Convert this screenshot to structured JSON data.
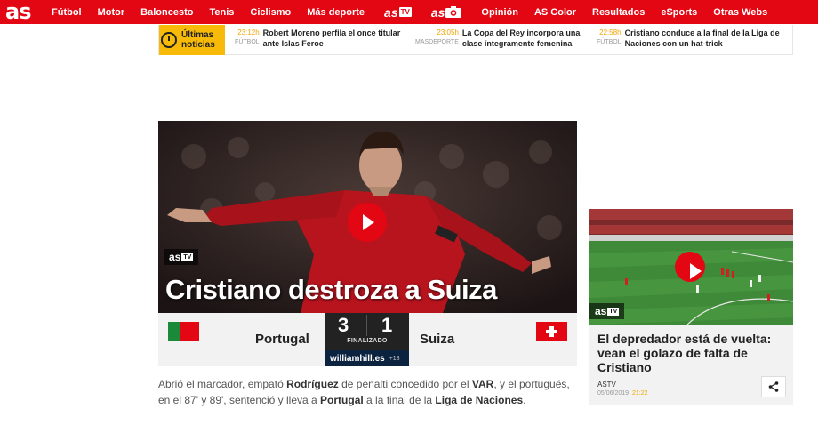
{
  "nav": {
    "logo": "as",
    "items": [
      "Fútbol",
      "Motor",
      "Baloncesto",
      "Tenis",
      "Ciclismo",
      "Más deporte"
    ],
    "astv_logo": "as",
    "astv_badge": "TV",
    "asfoto_logo": "as",
    "items_right": [
      "Opinión",
      "AS Color",
      "Resultados",
      "eSports",
      "Otras Webs"
    ]
  },
  "ticker": {
    "label": "Últimas noticias",
    "items": [
      {
        "time": "23:12h",
        "section": "FÚTBOL",
        "title": "Robert Moreno perfila el once titular ante Islas Feroe"
      },
      {
        "time": "23:05h",
        "section": "MASDEPORTE",
        "title": "La Copa del Rey incorpora una clase íntegramente femenina"
      },
      {
        "time": "22:58h",
        "section": "FÚTBOL",
        "title": "Cristiano conduce a la final de la Liga de Naciones con un hat-trick"
      }
    ]
  },
  "hero": {
    "tag_logo": "as",
    "tag_badge": "TV",
    "title": "Cristiano destroza a Suiza"
  },
  "match": {
    "home_team": "Portugal",
    "away_team": "Suiza",
    "home_score": "3",
    "away_score": "1",
    "status": "FINALIZADO",
    "sponsor": "williamhill.es",
    "age": "+18"
  },
  "summary": {
    "p1": "Abrió el marcador, empató ",
    "b1": "Rodríguez",
    "p2": " de penalti concedido por el ",
    "b2": "VAR",
    "p3": ", y el portugués, en el 87' y 89', sentenció y lleva a ",
    "b3": "Portugal",
    "p4": " a la final de la ",
    "b4": "Liga de Naciones",
    "p5": "."
  },
  "side_card": {
    "tag_logo": "as",
    "tag_badge": "TV",
    "title": "El depredador está de vuelta: vean el golazo de falta de Cristiano",
    "source": "ASTV",
    "date": "05/06/2019",
    "time": "21:22"
  },
  "colors": {
    "brand": "#e30613",
    "accent": "#f7ba08"
  }
}
